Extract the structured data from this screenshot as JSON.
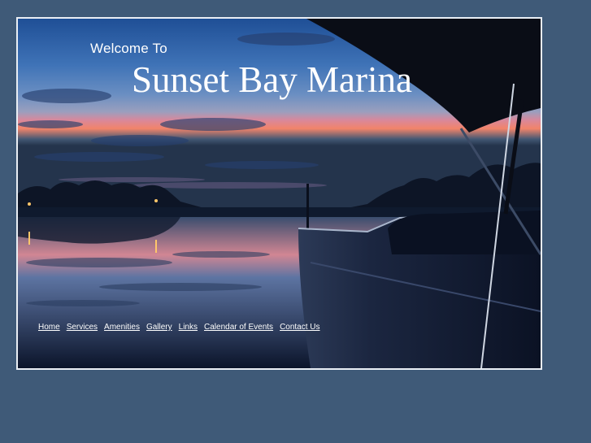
{
  "header": {
    "welcome": "Welcome To",
    "title": "Sunset Bay Marina"
  },
  "nav": {
    "items": [
      {
        "label": "Home"
      },
      {
        "label": "Services"
      },
      {
        "label": "Amenities"
      },
      {
        "label": "Gallery"
      },
      {
        "label": "Links"
      },
      {
        "label": "Calendar of Events"
      },
      {
        "label": "Contact Us"
      }
    ]
  },
  "colors": {
    "page_background": "#3f5a78",
    "frame_border": "#e9eef4",
    "text": "#ffffff"
  }
}
